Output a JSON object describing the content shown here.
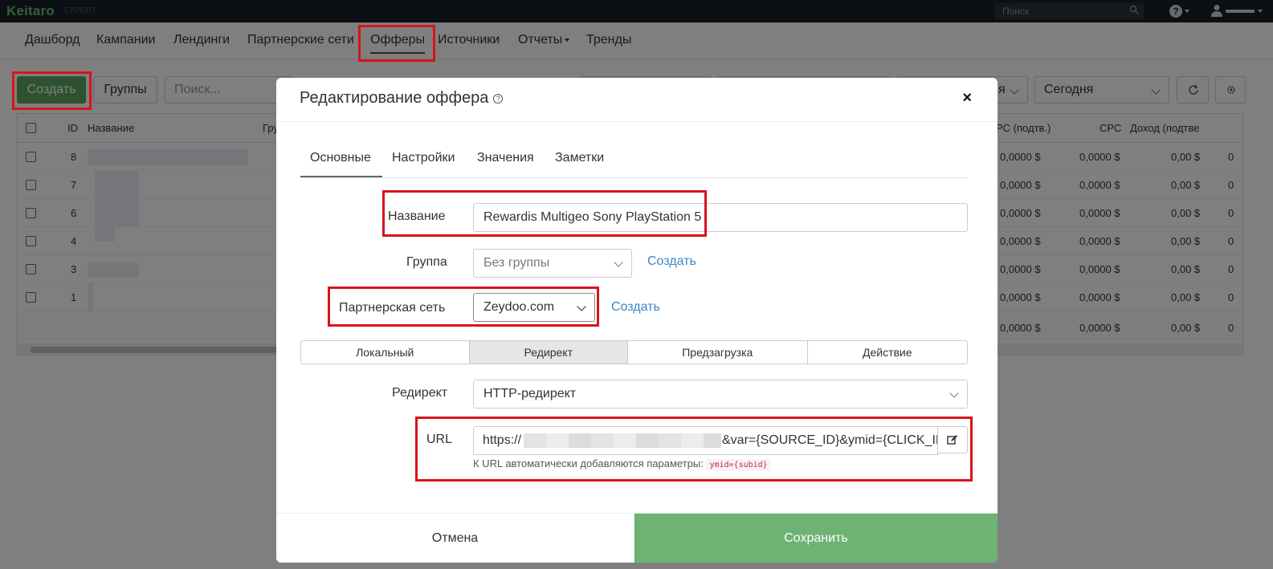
{
  "topbar": {
    "logo": "Keitaro",
    "edition": "EXPERT",
    "search_placeholder": "Поиск",
    "help_label": "?"
  },
  "nav": {
    "items": [
      {
        "label": "Дашборд"
      },
      {
        "label": "Кампании"
      },
      {
        "label": "Лендинги"
      },
      {
        "label": "Партнерские сети"
      },
      {
        "label": "Офферы"
      },
      {
        "label": "Источники"
      },
      {
        "label": "Отчеты"
      },
      {
        "label": "Тренды"
      }
    ],
    "active": "Офферы"
  },
  "toolbar": {
    "create_label": "Создать",
    "groups_label": "Группы",
    "search_placeholder": "Поиск...",
    "period_value": "Сегодня",
    "filter_partial": "я"
  },
  "table": {
    "headers": {
      "id": "ID",
      "name": "Название",
      "group_partial": "Гру",
      "cpc_confirmed": "PC (подтв.)",
      "cpc": "CPC",
      "revenue": "Доход (подтве"
    },
    "rows": [
      {
        "id": "8",
        "cpc_confirmed": "0,0000 $",
        "cpc": "0,0000 $",
        "revenue": "0,00 $",
        "last": "0"
      },
      {
        "id": "7",
        "cpc_confirmed": "0,0000 $",
        "cpc": "0,0000 $",
        "revenue": "0,00 $",
        "last": "0"
      },
      {
        "id": "6",
        "cpc_confirmed": "0,0000 $",
        "cpc": "0,0000 $",
        "revenue": "0,00 $",
        "last": "0"
      },
      {
        "id": "4",
        "cpc_confirmed": "0,0000 $",
        "cpc": "0,0000 $",
        "revenue": "0,00 $",
        "last": "0"
      },
      {
        "id": "3",
        "cpc_confirmed": "0,0000 $",
        "cpc": "0,0000 $",
        "revenue": "0,00 $",
        "last": "0"
      },
      {
        "id": "1",
        "cpc_confirmed": "0,0000 $",
        "cpc": "0,0000 $",
        "revenue": "0,00 $",
        "last": "0"
      }
    ],
    "totals": {
      "cpc_confirmed": "0,0000 $",
      "cpc": "0,0000 $",
      "revenue": "0,00 $",
      "last": "0"
    }
  },
  "modal": {
    "title": "Редактирование оффера",
    "info_icon": "?",
    "close_label": "×",
    "tabs": [
      {
        "label": "Основные"
      },
      {
        "label": "Настройки"
      },
      {
        "label": "Значения"
      },
      {
        "label": "Заметки"
      }
    ],
    "form": {
      "name_label": "Название",
      "name_value": "Rewardis Multigeo Sony PlayStation 5",
      "group_label": "Группа",
      "group_value": "Без группы",
      "group_create_link": "Создать",
      "network_label": "Партнерская сеть",
      "network_value": "Zeydoo.com",
      "network_create_link": "Создать",
      "type_options": [
        {
          "label": "Локальный"
        },
        {
          "label": "Редирект"
        },
        {
          "label": "Предзагрузка"
        },
        {
          "label": "Действие"
        }
      ],
      "type_active": "Редирект",
      "redirect_label": "Редирект",
      "redirect_value": "HTTP-редирект",
      "url_label": "URL",
      "url_prefix": "https://",
      "url_suffix": "&var={SOURCE_ID}&ymid={CLICK_ID}",
      "url_help": "К URL автоматически добавляются параметры:",
      "url_help_code": "ymid={subid}"
    },
    "footer": {
      "cancel_label": "Отмена",
      "save_label": "Сохранить"
    }
  },
  "colors": {
    "highlight": "#d7141a",
    "save_green": "#6db373",
    "create_green": "#5aa55e",
    "link_blue": "#3a87c8",
    "topbar_bg": "#152127"
  }
}
